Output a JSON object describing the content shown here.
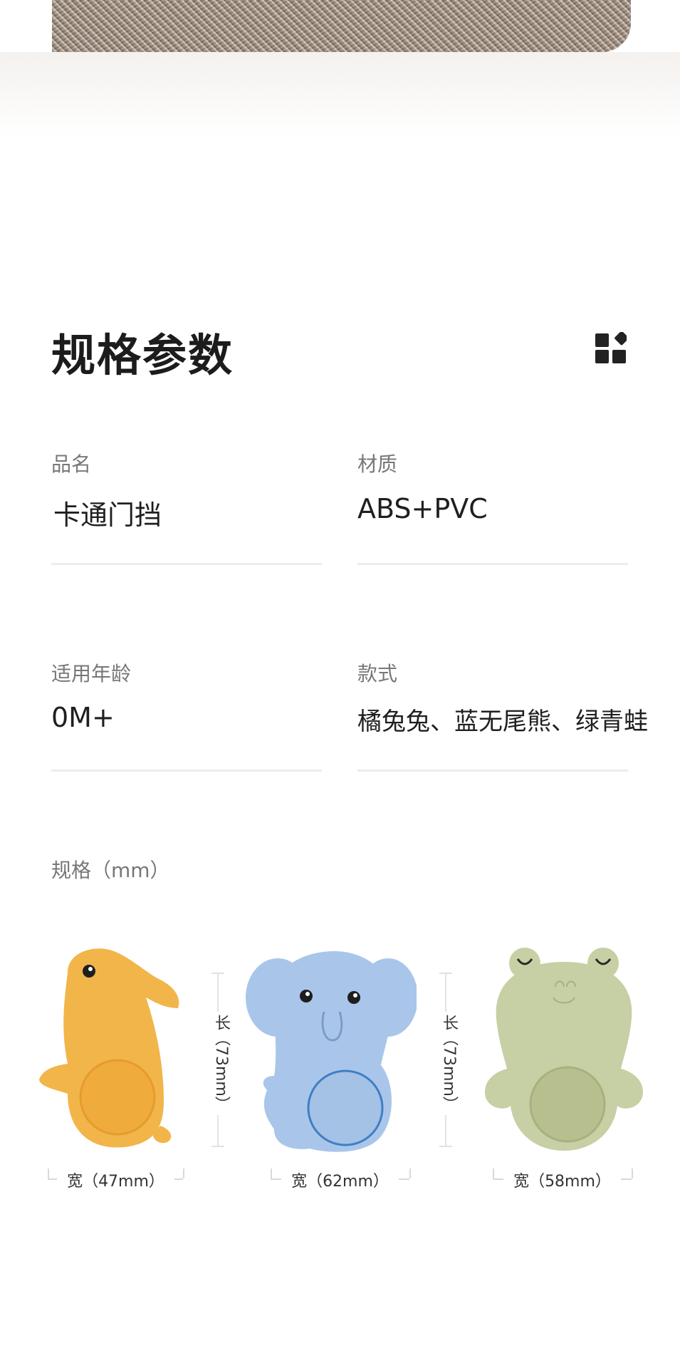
{
  "section": {
    "title": "规格参数"
  },
  "specs": [
    {
      "label": "品名",
      "value": "卡通门挡"
    },
    {
      "label": "材质",
      "value": "ABS+PVC"
    },
    {
      "label": "适用年龄",
      "value": "0M+"
    },
    {
      "label": "款式",
      "value": "橘兔兔、蓝无尾熊、绿青蛙"
    }
  ],
  "size_label": "规格（mm）",
  "products": [
    {
      "name": "rabbit",
      "color": "#f2b54a",
      "width_label": "宽（47mm）"
    },
    {
      "name": "koala",
      "color": "#a9c6ea",
      "width_label": "宽（62mm）"
    },
    {
      "name": "frog",
      "color": "#c7cfa4",
      "width_label": "宽（58mm）"
    }
  ],
  "height_labels": [
    "长（73mm）",
    "长（73mm）"
  ],
  "icons": [
    "grid-icon"
  ]
}
